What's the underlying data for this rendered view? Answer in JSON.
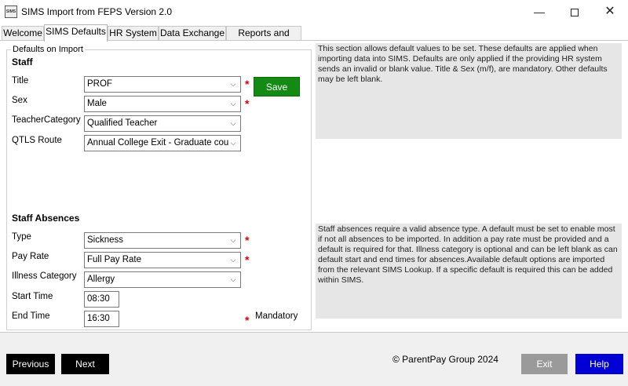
{
  "window": {
    "title": "SIMS Import from FEPS Version 2.0",
    "icon_label": "SIMS",
    "controls": {
      "minimize": "—",
      "close": "✕"
    }
  },
  "tabs": [
    {
      "label": "Welcome"
    },
    {
      "label": "SIMS Defaults",
      "active": true
    },
    {
      "label": "HR System"
    },
    {
      "label": "Data Exchange"
    },
    {
      "label": "Reports and Tools"
    }
  ],
  "defaults": {
    "group_title": "Defaults on Import",
    "staff": {
      "heading": "Staff",
      "title": {
        "label": "Title",
        "value": "PROF"
      },
      "sex": {
        "label": "Sex",
        "value": "Male"
      },
      "teacher_category": {
        "label": "TeacherCategory",
        "value": "Qualified Teacher"
      },
      "qtls_route": {
        "label": "QTLS Route",
        "value": "Annual College Exit - Graduate course"
      }
    },
    "absences": {
      "heading": "Staff Absences",
      "type": {
        "label": "Type",
        "value": "Sickness"
      },
      "pay_rate": {
        "label": "Pay Rate",
        "value": "Full Pay Rate"
      },
      "illness_category": {
        "label": "Illness Category",
        "value": "Allergy"
      },
      "start_time": {
        "label": "Start Time",
        "value": "08:30"
      },
      "end_time": {
        "label": "End Time",
        "value": "16:30"
      }
    },
    "required_marker": "*",
    "mandatory_label": "Mandatory",
    "save_label": "Save"
  },
  "info": {
    "staff_text": "This section allows default values to be set.  These defaults are applied when importing data into SIMS. Defaults are only applied if the providing HR system sends an invalid or blank value. Title & Sex (m/f), are mandatory.  Other defaults may be left blank.",
    "absences_text": "Staff absences require a valid absence type.  A default must be set to enable most if not all absences to be imported.  In addition a pay rate must be provided and a default is required for that.  Illness category is optional and can be left blank as can default start and end times for absences.Available default options are imported from the relevant SIMS Lookup.  If a specific default is required this can be added within SIMS."
  },
  "footer": {
    "previous_label": "Previous",
    "next_label": "Next",
    "copyright": "© ParentPay Group 2024",
    "exit_label": "Exit",
    "help_label": "Help"
  },
  "colors": {
    "save": "#138a13",
    "help": "#0000d4",
    "exit": "#9a9a9a",
    "required": "#e00000"
  }
}
